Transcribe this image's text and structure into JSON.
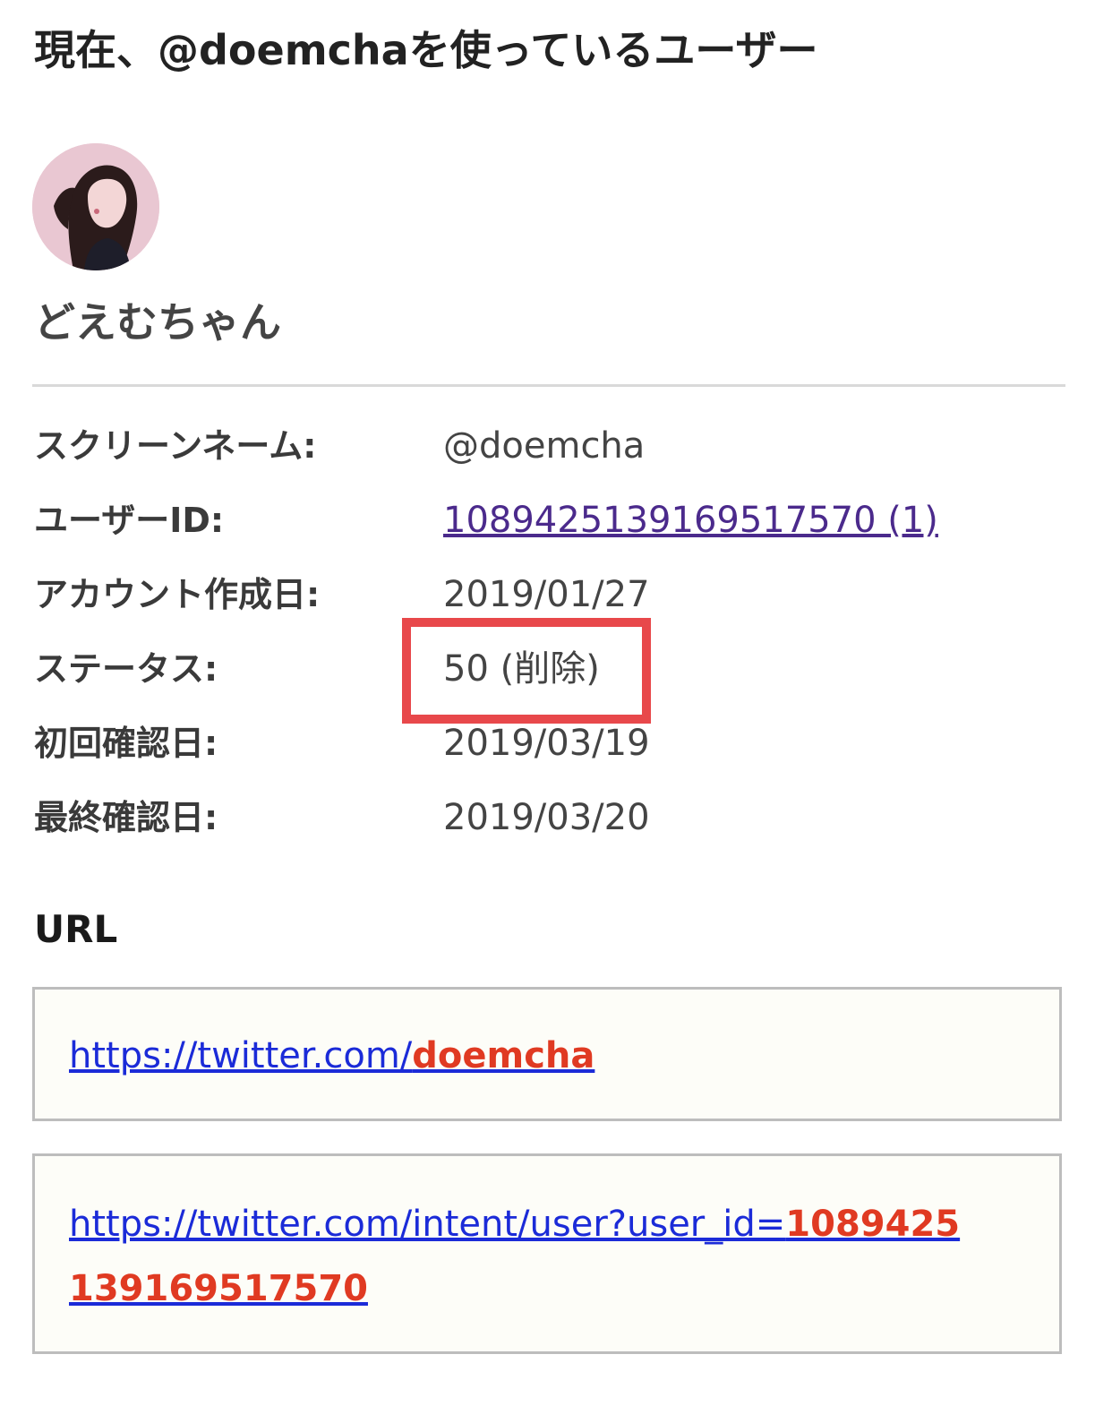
{
  "page": {
    "title": "現在、@doemchaを使っているユーザー"
  },
  "profile": {
    "display_name": "どえむちゃん"
  },
  "info": [
    {
      "label": "スクリーンネーム:",
      "value": "@doemcha"
    },
    {
      "label": "ユーザーID:",
      "value": "1089425139169517570 (1)"
    },
    {
      "label": "アカウント作成日:",
      "value": "2019/01/27"
    },
    {
      "label": "ステータス:",
      "value": "50 (削除)"
    },
    {
      "label": "初回確認日:",
      "value": "2019/03/19"
    },
    {
      "label": "最終確認日:",
      "value": "2019/03/20"
    }
  ],
  "url_section": {
    "heading": "URL",
    "links": [
      {
        "prefix": "https://twitter.com/",
        "highlight": "doemcha",
        "rest": ""
      },
      {
        "prefix": "https://twitter.com/intent/user?user_id=",
        "highlight": "1089425",
        "rest": "139169517570"
      }
    ]
  },
  "colors": {
    "link_blue": "#1b2bd8",
    "link_visited": "#4b2a8c",
    "highlight_red": "#e03a22",
    "annotation_box": "#e8484b",
    "url_box_bg": "#fdfdf8"
  },
  "icons": {
    "avatar": "profile-avatar"
  }
}
